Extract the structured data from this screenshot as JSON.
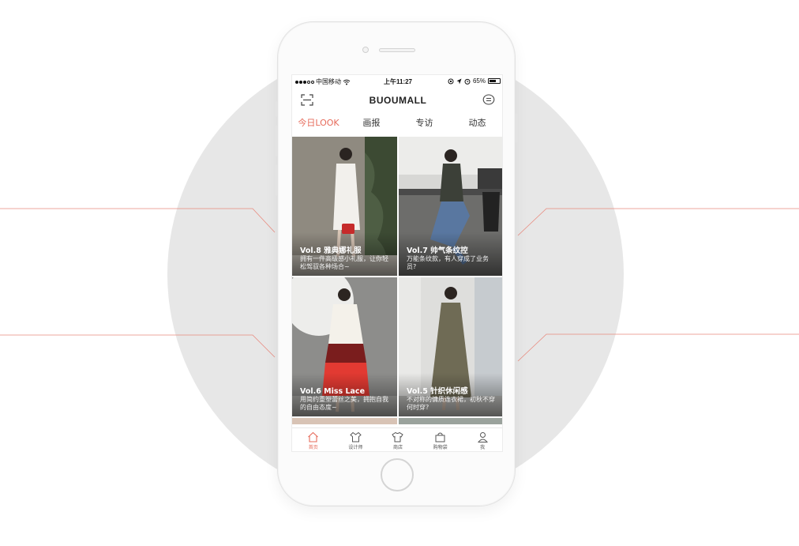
{
  "status_bar": {
    "carrier": "中国移动",
    "time": "上午11:27",
    "battery": "65%"
  },
  "nav": {
    "brand": "BUOUMALL"
  },
  "tabs": [
    {
      "label": "今日LOOK",
      "active": true
    },
    {
      "label": "画报",
      "active": false
    },
    {
      "label": "专访",
      "active": false
    },
    {
      "label": "动态",
      "active": false
    }
  ],
  "cards": [
    {
      "title": "Vol.8 雅典娜礼服",
      "desc": "拥有一件高级感小礼服，让你轻松驾驭各种场合~"
    },
    {
      "title": "Vol.7 帅气条纹控",
      "desc": "万能条纹款，有人穿成了业务员?"
    },
    {
      "title": "Vol.6 Miss Lace",
      "desc": "用简约重塑蕾丝之美，拥抱自我的自由态度~"
    },
    {
      "title": "Vol.5 针织休闲感",
      "desc": "不对称的慵质连衣裙，初秋不穿何时穿?"
    }
  ],
  "tab_bar": [
    {
      "label": "首页",
      "icon": "home-icon",
      "active": true
    },
    {
      "label": "设计师",
      "icon": "designer-shirt-icon",
      "active": false
    },
    {
      "label": "商店",
      "icon": "shop-tshirt-icon",
      "active": false
    },
    {
      "label": "购物袋",
      "icon": "shopping-bag-icon",
      "active": false
    },
    {
      "label": "我",
      "icon": "profile-icon",
      "active": false
    }
  ],
  "colors": {
    "accent": "#e66b5b",
    "background_circle": "#e7e7e7",
    "leader_line": "#e88a7e"
  }
}
